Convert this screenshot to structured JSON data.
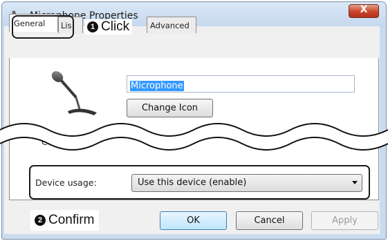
{
  "window": {
    "title": "Microphone Properties",
    "close_label": "X"
  },
  "tabs": [
    {
      "label": "General",
      "active": true
    },
    {
      "label": "Lis",
      "active": false
    },
    {
      "label": "Advanced",
      "active": false
    }
  ],
  "callouts": {
    "step1_number": "1",
    "step1_text": "Click",
    "step2_number": "2",
    "step2_text": "Confirm"
  },
  "general": {
    "device_name": "Microphone",
    "change_icon_label": "Change Icon",
    "partial_text": "Cont"
  },
  "device_usage": {
    "label": "Device usage:",
    "value": "Use this device (enable)"
  },
  "buttons": {
    "ok": "OK",
    "cancel": "Cancel",
    "apply": "Apply"
  },
  "colors": {
    "title_bar": "#c4d7ed",
    "close_button": "#c8442b",
    "selection": "#3399ff",
    "ok_button_border": "#3c7fb1"
  },
  "icons": [
    "microphone-icon",
    "close-icon",
    "dropdown-arrow-icon"
  ]
}
